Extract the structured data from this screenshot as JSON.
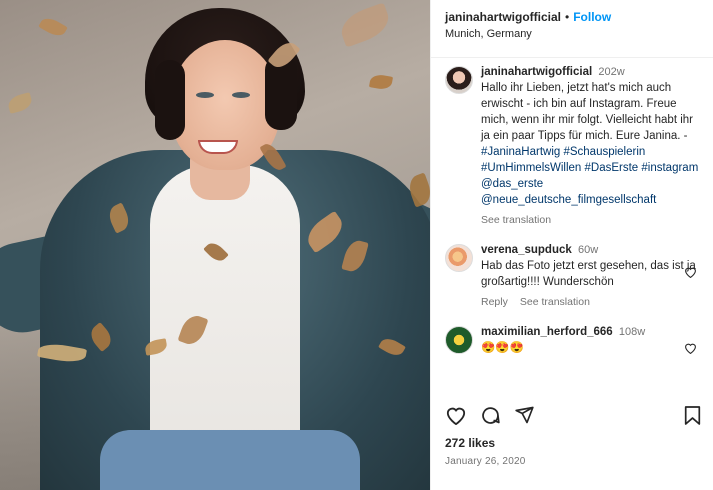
{
  "post": {
    "author": "janinahartwigofficial",
    "separator": "•",
    "follow_label": "Follow",
    "location": "Munich, Germany",
    "image_alt": "Photo of a smiling woman in a leather jacket with autumn leaves"
  },
  "caption": {
    "username": "janinahartwigofficial",
    "age": "202w",
    "text": "Hallo ihr Lieben, jetzt hat's mich auch erwischt - ich bin auf Instagram. Freue mich, wenn ihr mir folgt. Vielleicht habt ihr ja ein paar Tipps für mich. Eure Janina. - ",
    "hashtags": "#JaninaHartwig #Schauspielerin #UmHimmelsWillen #DasErste #instagram @das_erste @neue_deutsche_filmgesellschaft",
    "see_translation": "See translation"
  },
  "comments": [
    {
      "username": "verena_supduck",
      "age": "60w",
      "text": "Hab das Foto jetzt erst gesehen, das ist ja großartig!!!! Wunderschön",
      "reply": "Reply",
      "see_translation": "See translation",
      "like_icon": "heart-outline-icon"
    },
    {
      "username": "maximilian_herford_666",
      "age": "108w",
      "text": "😍😍😍",
      "like_icon": "heart-outline-icon"
    }
  ],
  "actions": {
    "like_icon": "heart-outline-icon",
    "comment_icon": "comment-bubble-icon",
    "share_icon": "paper-plane-icon",
    "save_icon": "bookmark-icon"
  },
  "likes": "272 likes",
  "date": "January 26, 2020",
  "colors": {
    "link_blue": "#0095f6",
    "tag_navy": "#00376b",
    "muted": "#737373"
  }
}
